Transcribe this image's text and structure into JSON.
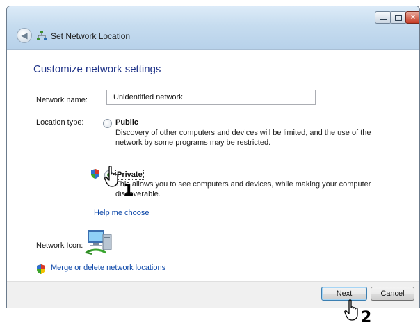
{
  "window": {
    "title": "Set Network Location",
    "buttons": {
      "minimize": "minimize",
      "maximize": "maximize",
      "close": "×"
    }
  },
  "content": {
    "heading": "Customize network settings",
    "network_name_label": "Network name:",
    "network_name_value": "Unidentified network",
    "location_type_label": "Location type:",
    "options": [
      {
        "title": "Public",
        "description": "Discovery of other computers and devices will be limited, and the use of the network by some programs may be restricted.",
        "selected": false
      },
      {
        "title": "Private",
        "description": "This allows you to see computers and devices, while making your computer discoverable.",
        "selected": true
      }
    ],
    "help_link": "Help me choose",
    "network_icon_label": "Network Icon:",
    "merge_link": "Merge or delete network locations"
  },
  "footer": {
    "next_label": "Next",
    "cancel_label": "Cancel"
  },
  "annotations": {
    "step_1": "1",
    "step_2": "2"
  },
  "icons": {
    "back": "back-arrow-icon",
    "title": "network-icon",
    "shield": "uac-shield-icon",
    "network_picture": "network-computers-icon",
    "cursor": "hand-cursor-icon"
  }
}
